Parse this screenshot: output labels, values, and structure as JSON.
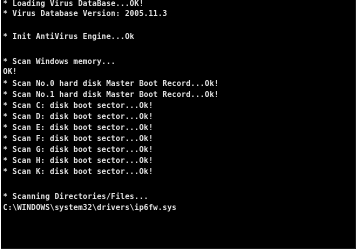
{
  "console": {
    "lines": [
      "* Loading Virus DataBase...OK!",
      "* Virus Database Version: 2005.11.3",
      "* Init AntiVirus Engine...Ok",
      "* Scan Windows memory...",
      "OK!",
      "* Scan No.0 hard disk Master Boot Record...Ok!",
      "* Scan No.1 hard disk Master Boot Record...Ok!",
      "* Scan C: disk boot sector...Ok!",
      "* Scan D: disk boot sector...Ok!",
      "* Scan E: disk boot sector...Ok!",
      "* Scan F: disk boot sector...Ok!",
      "* Scan G: disk boot sector...Ok!",
      "* Scan H: disk boot sector...Ok!",
      "* Scan K: disk boot sector...Ok!",
      "* Scanning Directories/Files...",
      "C:\\WINDOWS\\system32\\drivers\\ip6fw.sys"
    ],
    "text_color": "#e4e4e4",
    "background_color": "#000000"
  }
}
